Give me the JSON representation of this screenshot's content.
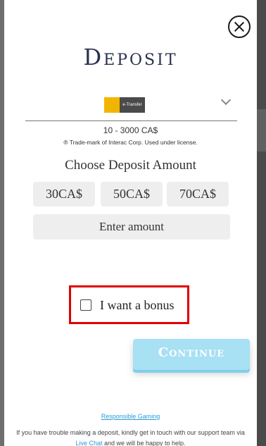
{
  "title": "Deposit",
  "payment_method": {
    "logo_left": "Interac",
    "logo_right": "e-Transfer"
  },
  "range": "10 - 3000 CA$",
  "trademark": "® Trade-mark of Interac Corp. Used under license.",
  "choose_label": "Choose Deposit Amount",
  "amounts": [
    "30CA$",
    "50CA$",
    "70CA$"
  ],
  "enter_amount": "Enter amount",
  "bonus": {
    "label": "I want a bonus",
    "checked": false
  },
  "continue_label": "Continue",
  "responsible_gaming": "Responsible Gaming",
  "footer": {
    "before": "If you have trouble making a deposit, kindly get in touch with our support team via ",
    "link": "Live Chat",
    "after": " and we will be happy to help."
  },
  "colors": {
    "title": "#27304f",
    "continue_bg": "#a8e0f4",
    "link": "#2b9ad6",
    "highlight": "#e00000"
  }
}
